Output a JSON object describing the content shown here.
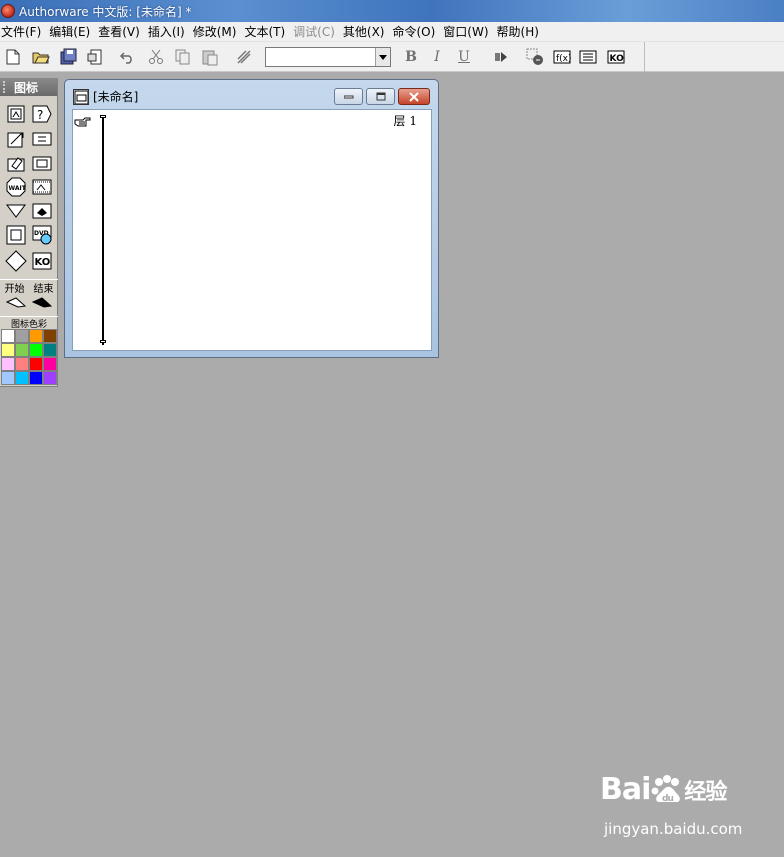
{
  "window": {
    "title": "Authorware 中文版: [未命名] *"
  },
  "menu": [
    "文件(F)",
    "编辑(E)",
    "查看(V)",
    "插入(I)",
    "修改(M)",
    "文本(T)",
    "调试(C)",
    "其他(X)",
    "命令(O)",
    "窗口(W)",
    "帮助(H)"
  ],
  "menu_disabled": [
    "调试(C)"
  ],
  "toolbar": {
    "buttons": [
      "new-icon",
      "open-icon",
      "save-all-icon",
      "import-icon",
      "undo-icon",
      "cut-icon",
      "copy-icon",
      "paste-icon",
      "find-icon"
    ],
    "style_combo_value": "",
    "bold": "B",
    "italic": "I",
    "underline": "U",
    "right_buttons": [
      "run-icon",
      "control-panel-icon",
      "functions-icon",
      "variables-icon",
      "knowledge-objects-icon"
    ]
  },
  "palette": {
    "title": "图标",
    "icons": [
      "display-icon",
      "interaction-icon",
      "motion-icon",
      "calculation-icon",
      "erase-icon",
      "map-icon",
      "wait-icon",
      "digital-movie-icon",
      "navigate-icon",
      "sound-icon",
      "framework-icon",
      "dvd-icon",
      "decision-icon",
      "knowledge-object-icon"
    ],
    "start_label": "开始",
    "end_label": "结束",
    "color_label": "图标色彩",
    "colors": [
      "#ffffff",
      "#a0a0a0",
      "#ff9a00",
      "#804000",
      "#ffff80",
      "#80d050",
      "#00ff00",
      "#008080",
      "#ffc0ff",
      "#ff8080",
      "#ff0000",
      "#ff00a0",
      "#a0c8ff",
      "#00c0ff",
      "#0000ff",
      "#a040ff"
    ]
  },
  "flow_window": {
    "title": "[未命名]",
    "layer_label": "层 1"
  },
  "watermark": {
    "logo": "Bai",
    "logo_suffix": "经验",
    "url": "jingyan.baidu.com"
  }
}
